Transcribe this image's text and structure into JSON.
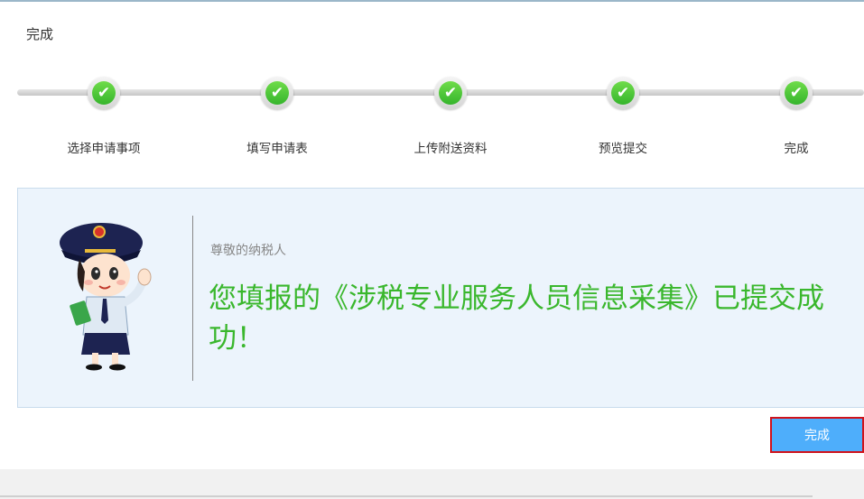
{
  "page": {
    "title": "完成"
  },
  "steps": [
    {
      "label": "选择申请事项",
      "check": "✔"
    },
    {
      "label": "填写申请表",
      "check": "✔"
    },
    {
      "label": "上传附送资料",
      "check": "✔"
    },
    {
      "label": "预览提交",
      "check": "✔"
    },
    {
      "label": "完成",
      "check": "✔"
    }
  ],
  "notice": {
    "greeting": "尊敬的纳税人",
    "message": "您填报的《涉税专业服务人员信息采集》已提交成功！"
  },
  "actions": {
    "finish_label": "完成"
  },
  "colors": {
    "accent_green": "#3ab72d",
    "button_blue": "#4eaefb",
    "highlight_red": "#d0121b",
    "panel_bg": "#ecf4fc"
  }
}
